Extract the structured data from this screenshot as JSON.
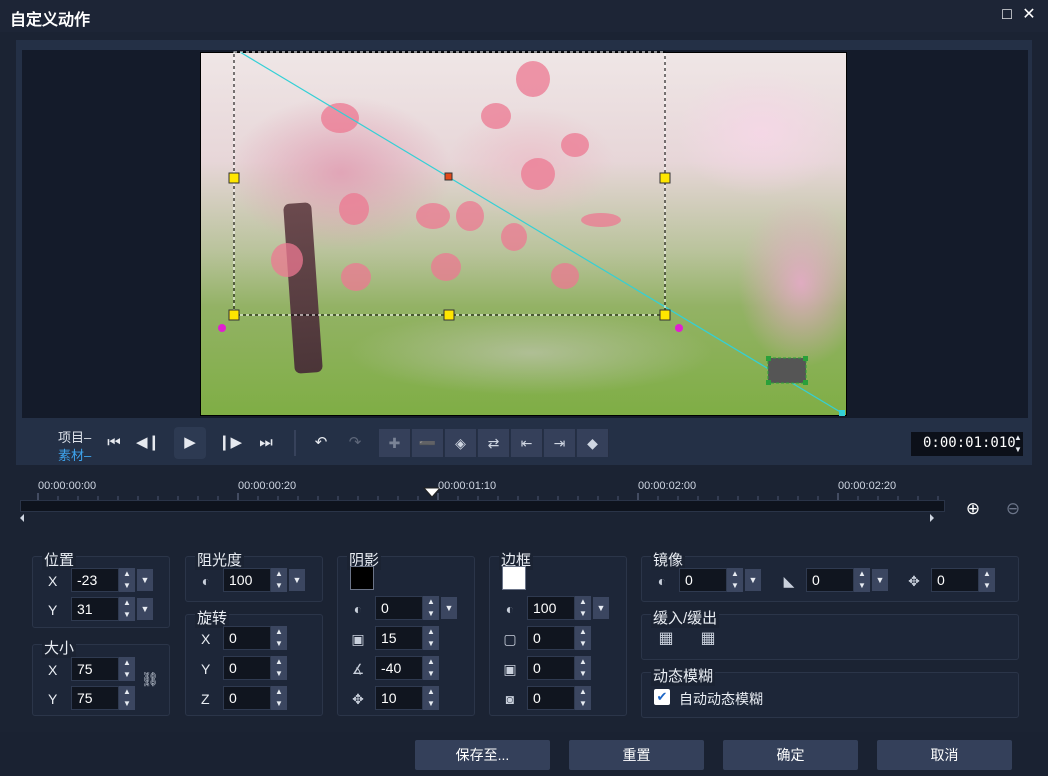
{
  "window": {
    "title": "自定义动作",
    "maximize_icon": "maximize-icon",
    "close_icon": "close-icon"
  },
  "transport": {
    "project_label": "项目",
    "clip_label": "素材",
    "timecode": "0:00:01:010"
  },
  "timeline": {
    "ruler": [
      "00:00:00:00",
      "00:00:00:20",
      "00:00:01:10",
      "00:00:02:00",
      "00:00:02:20"
    ]
  },
  "position": {
    "label": "位置",
    "x_label": "X",
    "x": "-23",
    "y_label": "Y",
    "y": "31"
  },
  "size": {
    "label": "大小",
    "x_label": "X",
    "x": "75",
    "y_label": "Y",
    "y": "75"
  },
  "opacity": {
    "label": "阻光度",
    "value": "100"
  },
  "rotation": {
    "label": "旋转",
    "x_label": "X",
    "x": "0",
    "y_label": "Y",
    "y": "0",
    "z_label": "Z",
    "z": "0"
  },
  "shadow": {
    "label": "阴影",
    "color": "#000000",
    "opacity": "0",
    "blur": "15",
    "angle": "-40",
    "distance": "10"
  },
  "border": {
    "label": "边框",
    "color": "#ffffff",
    "opacity": "100",
    "width": "0",
    "blur": "0",
    "softness": "0"
  },
  "mirror": {
    "label": "镜像",
    "opacity": "0",
    "fade": "0",
    "offset": "0"
  },
  "ease": {
    "label": "缓入/缓出"
  },
  "motion_blur": {
    "label": "动态模糊",
    "auto_label": "自动动态模糊",
    "checked": true
  },
  "buttons": {
    "save_as": "保存至...",
    "reset": "重置",
    "ok": "确定",
    "cancel": "取消"
  }
}
